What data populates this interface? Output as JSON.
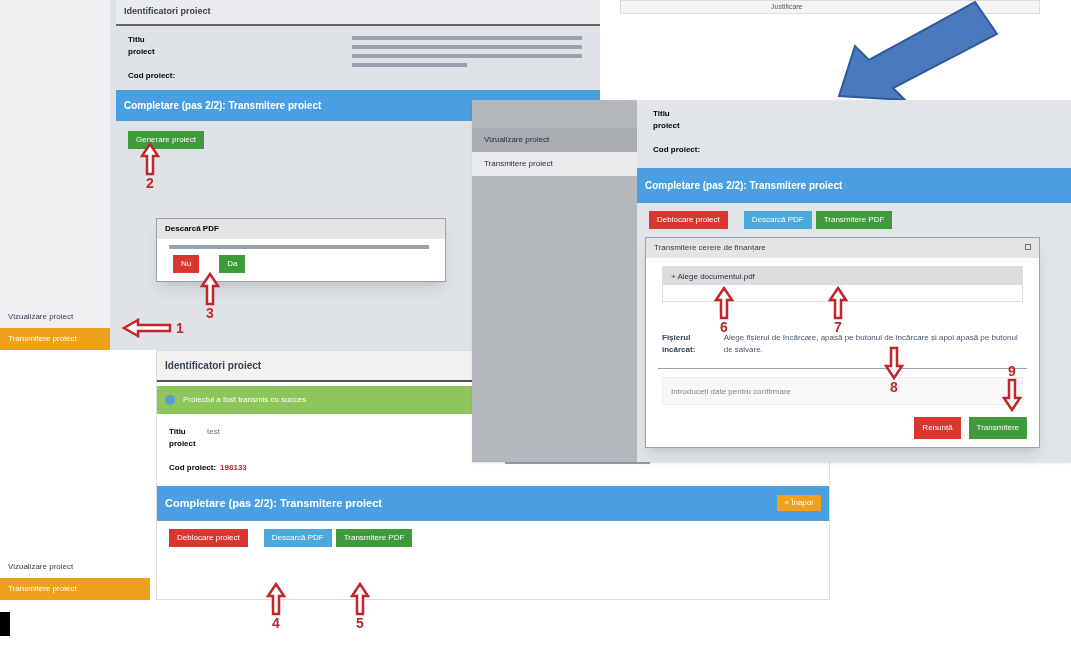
{
  "top_fragment": {
    "label": "Justificare"
  },
  "screen_a": {
    "sidebar_items": [
      {
        "label": "Vizualizare proiect",
        "selected": false
      },
      {
        "label": "Transmitere proiect",
        "selected": true
      }
    ],
    "header": "Identificatori proiect",
    "title_label": "Titlu proiect",
    "code_label": "Cod proiect:",
    "step_title": "Completare (pas 2/2): Transmitere proiect",
    "generate_button": "Generare proiect",
    "dialog": {
      "title": "Descarcă PDF",
      "buttons": [
        {
          "label": "Nu",
          "kind": "danger"
        },
        {
          "label": "Da",
          "kind": "success"
        }
      ]
    }
  },
  "screen_c": {
    "sidebar_items": [
      {
        "label": "Vizualizare proiect",
        "selected": false
      },
      {
        "label": "Transmitere proiect",
        "selected": true
      }
    ],
    "header": "Identificatori proiect",
    "alert": "Proiectul a fost transmis cu succes",
    "title_label": "Titlu proiect",
    "title_value": "test",
    "code_label": "Cod proiect:",
    "code_value": "198133",
    "step_title": "Completare (pas 2/2): Transmitere proiect",
    "back_button": "« Înapoi",
    "buttons": [
      {
        "label": "Deblocare proiect",
        "kind": "danger"
      },
      {
        "label": "Descarcă PDF",
        "kind": "info"
      },
      {
        "label": "Transmitere PDF",
        "kind": "success"
      }
    ]
  },
  "screen_b": {
    "sidebar_items": [
      {
        "label": "Vizualizare proiect",
        "selected": false
      },
      {
        "label": "Transmitere proiect",
        "selected": true
      }
    ],
    "title_label": "Titlu proiect",
    "code_label": "Cod proiect:",
    "step_title": "Completare (pas 2/2): Transmitere proiect",
    "buttons": [
      {
        "label": "Deblocare proiect",
        "kind": "danger"
      },
      {
        "label": "Descarcă PDF",
        "kind": "info"
      },
      {
        "label": "Transmitere PDF",
        "kind": "success"
      }
    ],
    "dialog": {
      "title": "Transmitere cerere de finanțare",
      "choose_button": "+ Alege documentul.pdf",
      "file_label": "Fișierul încărcat:",
      "help": "Alege fișierul de încărcare, apasă pe butonul de încărcare și apoi apasă pe butonul de salvare.",
      "placeholder": "Introduceți date pentru confirmare",
      "buttons": [
        {
          "label": "Renunță",
          "kind": "danger"
        },
        {
          "label": "Transmitere",
          "kind": "success"
        }
      ]
    }
  },
  "annotations": [
    {
      "number": "1",
      "kind": "left"
    },
    {
      "number": "2",
      "kind": "up"
    },
    {
      "number": "3",
      "kind": "up"
    },
    {
      "number": "4",
      "kind": "up"
    },
    {
      "number": "5",
      "kind": "up"
    },
    {
      "number": "6",
      "kind": "up"
    },
    {
      "number": "7",
      "kind": "up"
    },
    {
      "number": "8",
      "kind": "down"
    },
    {
      "number": "9",
      "kind": "down"
    }
  ]
}
